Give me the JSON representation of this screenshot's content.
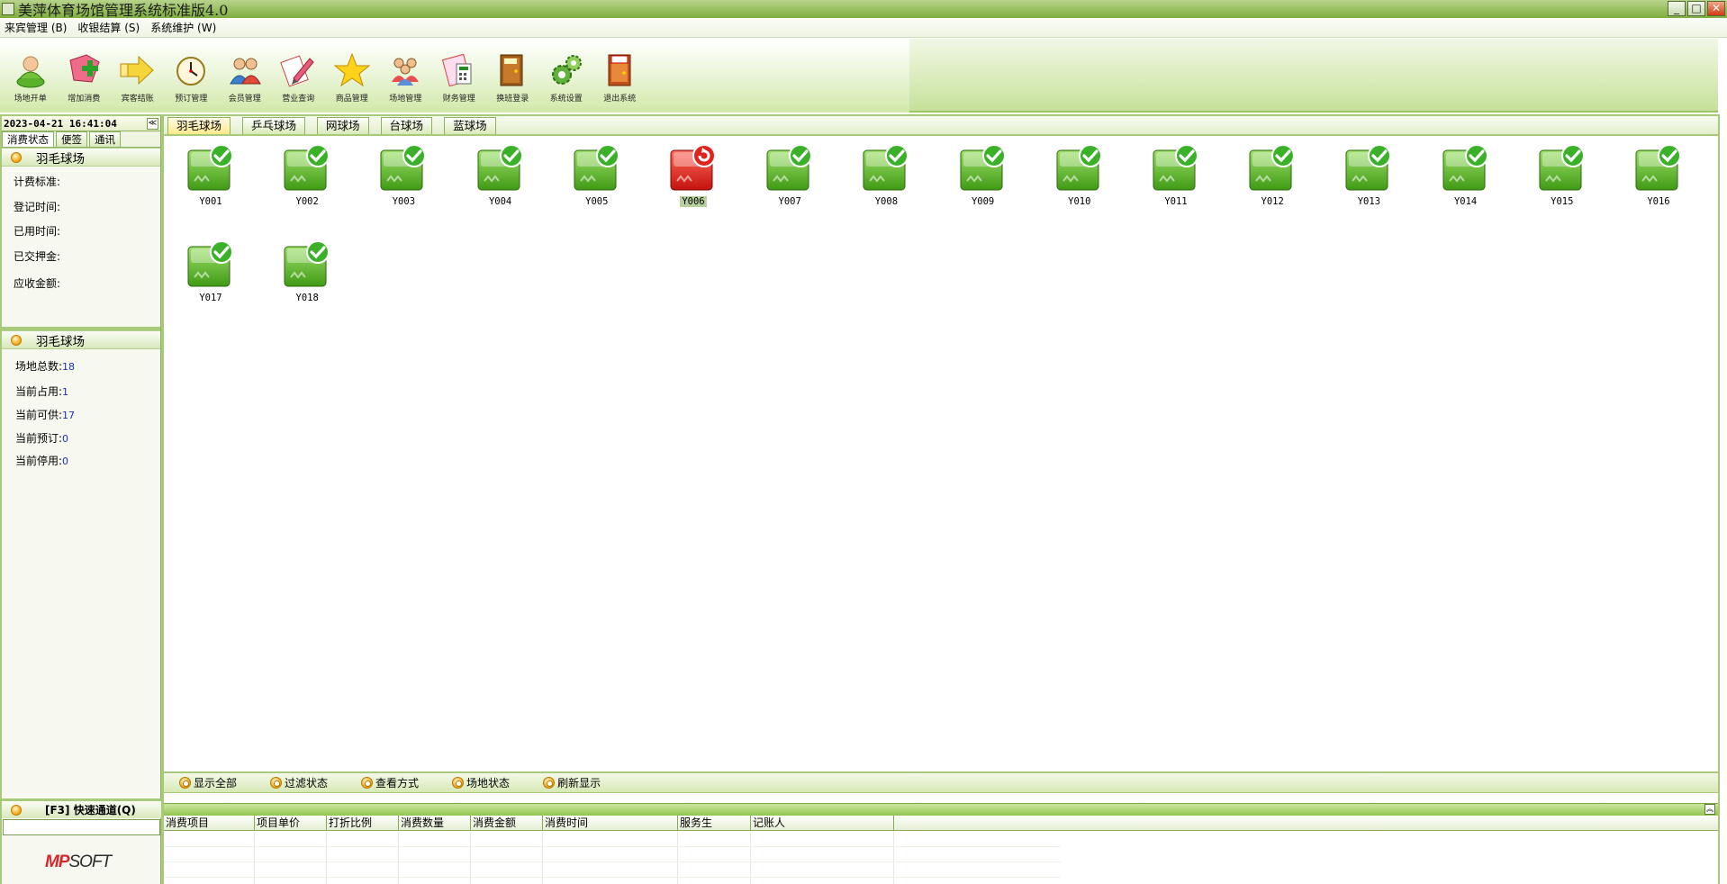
{
  "window": {
    "title": "美萍体育场馆管理系统标准版4.0",
    "buttons": {
      "minimize": "_",
      "maximize": "□",
      "close": "✕"
    }
  },
  "menu": [
    {
      "label": "来宾管理 (B)"
    },
    {
      "label": "收银结算 (S)"
    },
    {
      "label": "系统维护 (W)"
    }
  ],
  "toolbar": [
    {
      "label": "场地开单",
      "icon": "person-open-icon"
    },
    {
      "label": "增加消费",
      "icon": "add-consume-icon"
    },
    {
      "label": "宾客结账",
      "icon": "checkout-arrow-icon"
    },
    {
      "label": "预订管理",
      "icon": "clock-booking-icon"
    },
    {
      "label": "会员管理",
      "icon": "members-icon"
    },
    {
      "label": "营业查询",
      "icon": "business-query-icon"
    },
    {
      "label": "商品管理",
      "icon": "star-goods-icon"
    },
    {
      "label": "场地管理",
      "icon": "venue-people-icon"
    },
    {
      "label": "财务管理",
      "icon": "finance-icon"
    },
    {
      "label": "换班登录",
      "icon": "shift-door-icon"
    },
    {
      "label": "系统设置",
      "icon": "settings-gears-icon"
    },
    {
      "label": "退出系统",
      "icon": "exit-door-icon"
    }
  ],
  "leftpanel": {
    "datetime": "2023-04-21 16:41:04",
    "collapse": "≪",
    "tabs": [
      "消费状态",
      "便签",
      "通讯"
    ],
    "consume_section": {
      "title": "羽毛球场",
      "rows": [
        "计费标准:",
        "登记时间:",
        "已用时间:",
        "已交押金:",
        "应收金额:"
      ]
    },
    "stats_section": {
      "title": "羽毛球场",
      "rows": [
        {
          "label": "场地总数:",
          "value": "18"
        },
        {
          "label": "当前占用:",
          "value": "1"
        },
        {
          "label": "当前可供:",
          "value": "17"
        },
        {
          "label": "当前预订:",
          "value": "0"
        },
        {
          "label": "当前停用:",
          "value": "0"
        }
      ]
    },
    "quick": {
      "title": "[F3] 快速通道(Q)",
      "value": ""
    },
    "logo": {
      "part1": "MP",
      "part2": "SOFT"
    }
  },
  "venue_tabs": [
    "羽毛球场",
    "乒乓球场",
    "网球场",
    "台球场",
    "蓝球场"
  ],
  "courts": [
    {
      "id": "Y001",
      "status": "available"
    },
    {
      "id": "Y002",
      "status": "available"
    },
    {
      "id": "Y003",
      "status": "available"
    },
    {
      "id": "Y004",
      "status": "available"
    },
    {
      "id": "Y005",
      "status": "available"
    },
    {
      "id": "Y006",
      "status": "occupied"
    },
    {
      "id": "Y007",
      "status": "available"
    },
    {
      "id": "Y008",
      "status": "available"
    },
    {
      "id": "Y009",
      "status": "available"
    },
    {
      "id": "Y010",
      "status": "available"
    },
    {
      "id": "Y011",
      "status": "available"
    },
    {
      "id": "Y012",
      "status": "available"
    },
    {
      "id": "Y013",
      "status": "available"
    },
    {
      "id": "Y014",
      "status": "available"
    },
    {
      "id": "Y015",
      "status": "available"
    },
    {
      "id": "Y016",
      "status": "available"
    },
    {
      "id": "Y017",
      "status": "available"
    },
    {
      "id": "Y018",
      "status": "available"
    }
  ],
  "filters": [
    "显示全部",
    "过滤状态",
    "查看方式",
    "场地状态",
    "刷新显示"
  ],
  "consume_table": {
    "columns": [
      "消费项目",
      "项目单价",
      "打折比例",
      "消费数量",
      "消费金额",
      "消费时间",
      "服务生",
      "记账人"
    ]
  },
  "colors": {
    "accent_green": "#7fae3e",
    "available": "#4caf1d",
    "occupied": "#e0201b",
    "stat_value": "#1a2fb8"
  }
}
